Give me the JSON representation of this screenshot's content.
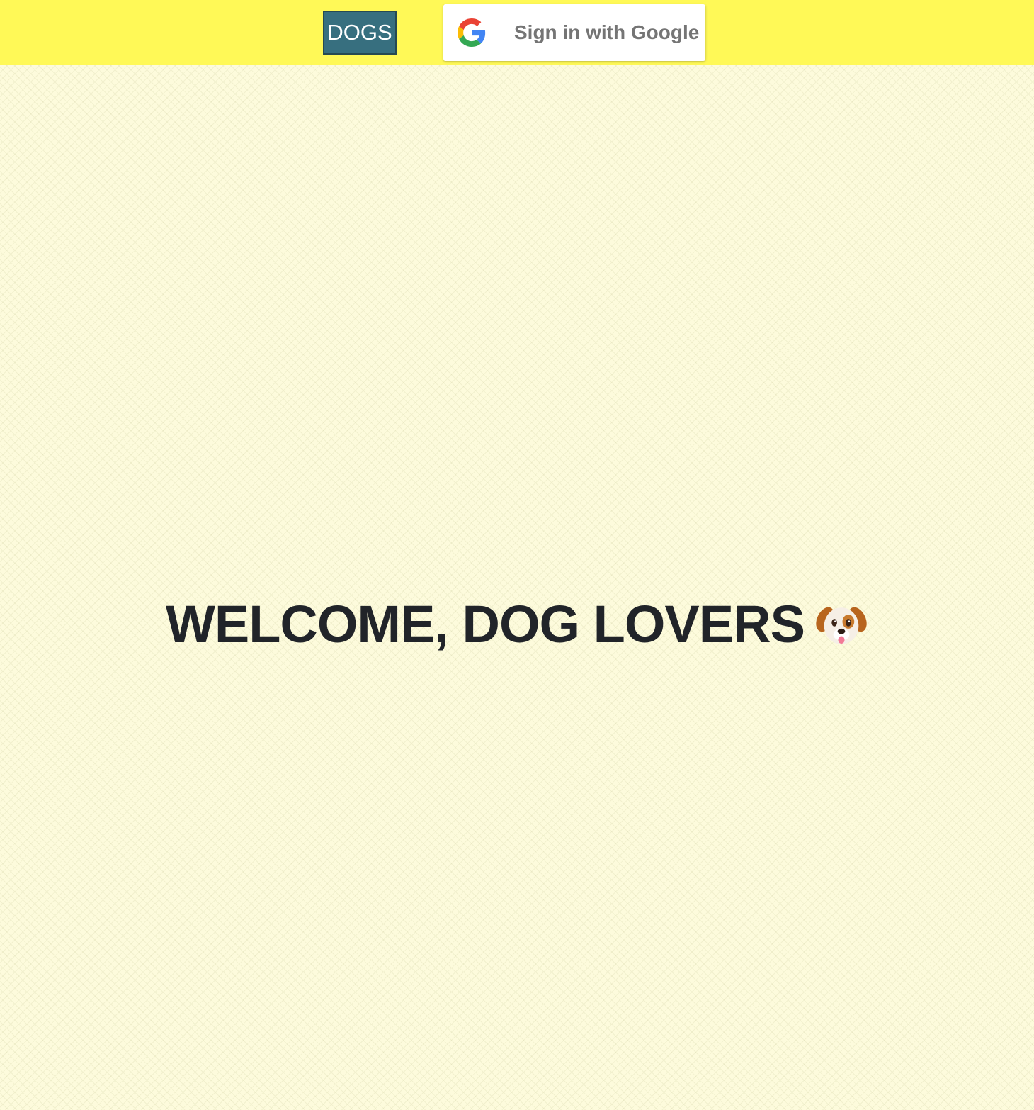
{
  "header": {
    "dogs_button_label": "DOGS",
    "google_sign_in_label": "Sign in with Google",
    "google_icon": "google-g-icon",
    "background_color": "#fff957"
  },
  "main": {
    "welcome_text": "WELCOME, DOG LOVERS",
    "welcome_icon": "dog-face-icon",
    "background_color": "#fdfbdc"
  },
  "colors": {
    "dogs_button_bg": "#376f7f",
    "heading_text": "#212429",
    "google_label_text": "#757575"
  }
}
